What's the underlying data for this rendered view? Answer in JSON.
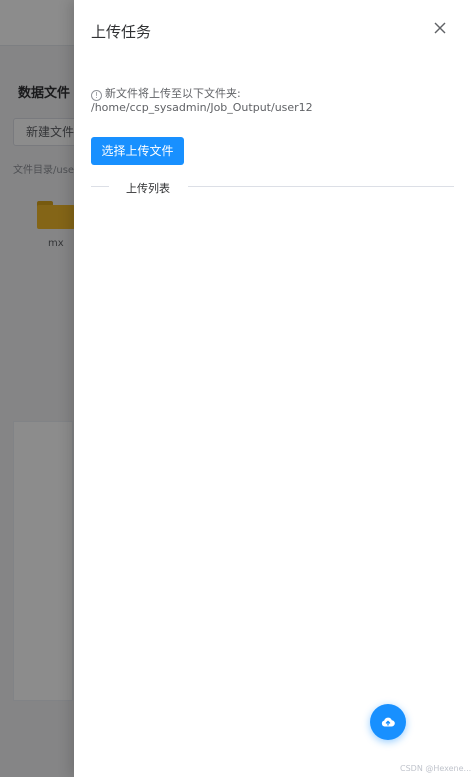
{
  "background": {
    "section_title": "数据文件",
    "new_file_button": "新建文件夹",
    "directory_label": "文件目录/user",
    "folder_name": "mx"
  },
  "drawer": {
    "title": "上传任务",
    "info_text": "新文件将上传至以下文件夹:",
    "target_path": "/home/ccp_sysadmin/Job_Output/user12",
    "select_button": "选择上传文件",
    "list_divider_label": "上传列表"
  },
  "watermark": "CSDN @Hexene...",
  "icons": {
    "close": "close-icon",
    "info": "info-icon",
    "upload": "cloud-upload-icon",
    "folder": "folder-icon"
  },
  "colors": {
    "primary": "#1890ff",
    "folder": "#f0b92b"
  }
}
